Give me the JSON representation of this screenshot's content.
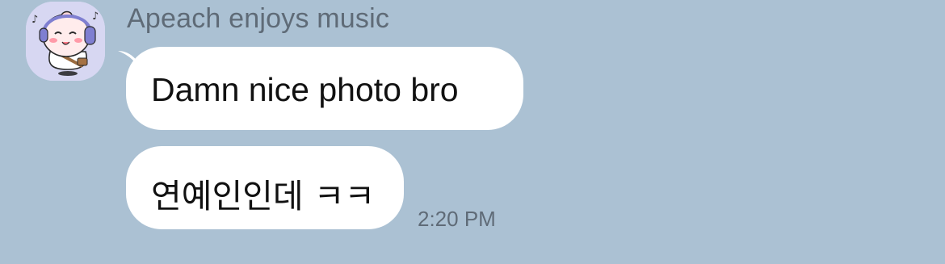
{
  "chat": {
    "sender_name": "Apeach enjoys music",
    "avatar_icon": "apeach-headphones-icon",
    "messages": [
      {
        "text": "Damn nice photo bro"
      },
      {
        "text": "연예인인데 ㅋㅋ"
      }
    ],
    "timestamp": "2:20 PM"
  },
  "colors": {
    "background": "#abc1d3",
    "bubble": "#ffffff",
    "meta_text": "#5f6b77"
  }
}
